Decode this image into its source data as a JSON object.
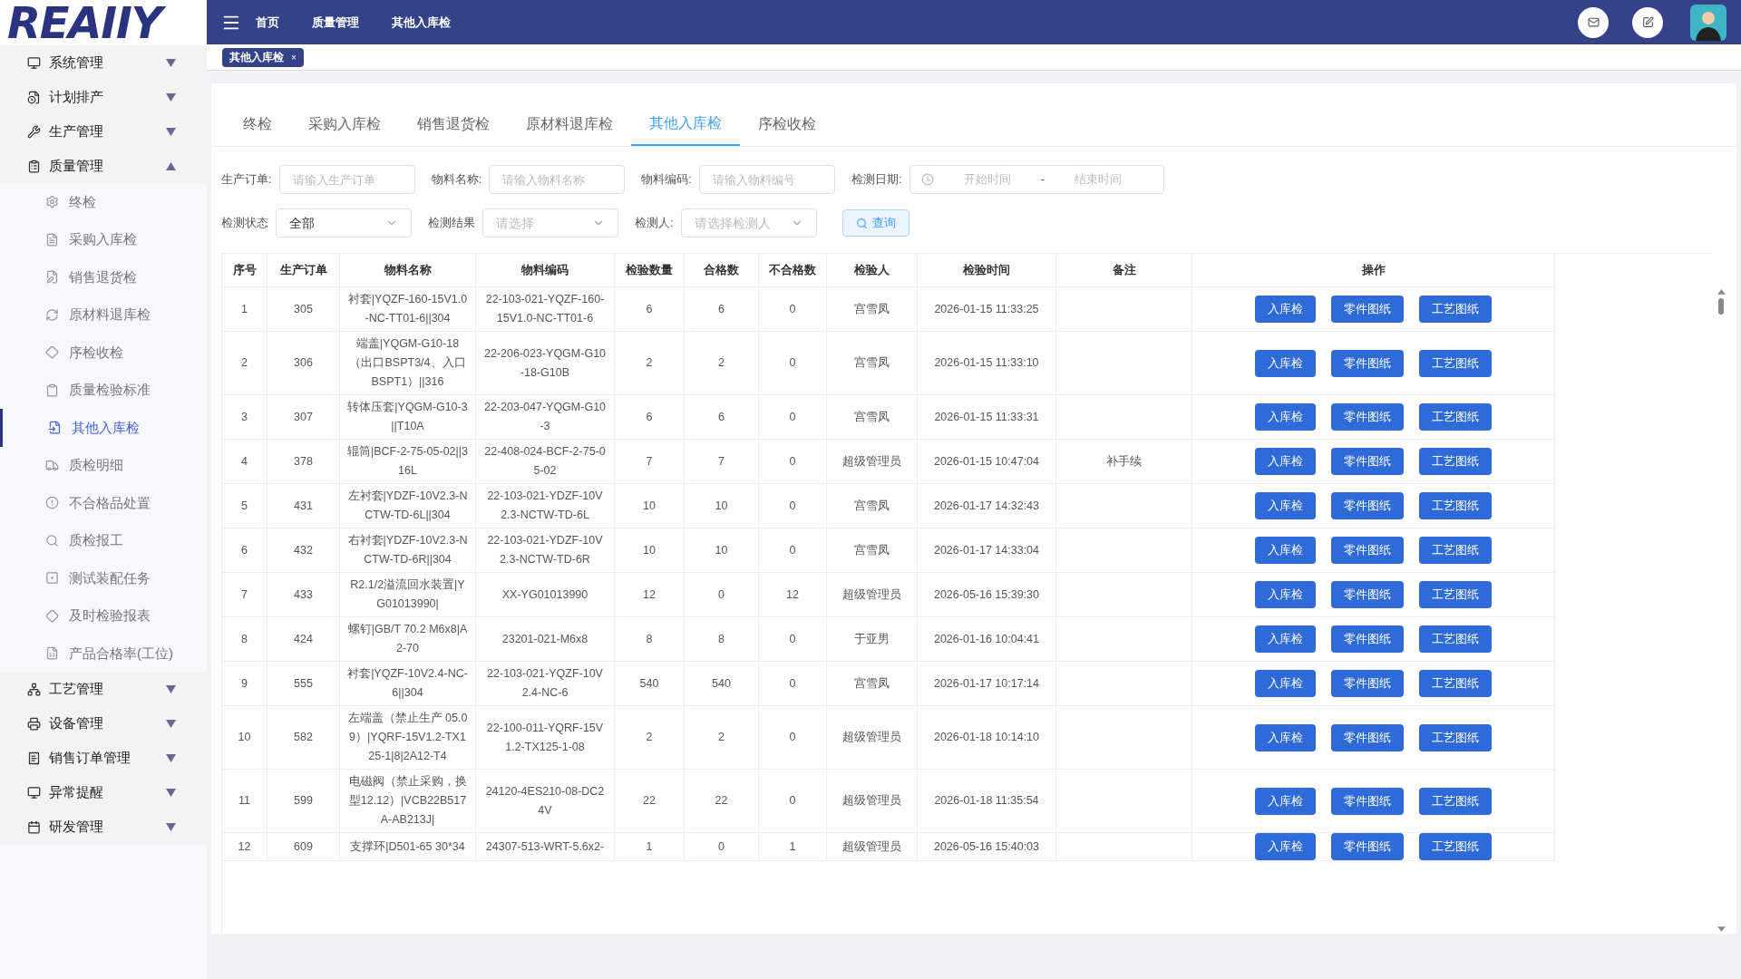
{
  "logo": "REAIIY",
  "sidebar": {
    "items": [
      {
        "label": "系统管理",
        "expanded": false
      },
      {
        "label": "计划排产",
        "expanded": false
      },
      {
        "label": "生产管理",
        "expanded": false
      },
      {
        "label": "质量管理",
        "expanded": true,
        "children": [
          {
            "label": "终检",
            "selected": false
          },
          {
            "label": "采购入库检",
            "selected": false
          },
          {
            "label": "销售退货检",
            "selected": false
          },
          {
            "label": "原材料退库检",
            "selected": false
          },
          {
            "label": "序检收检",
            "selected": false
          },
          {
            "label": "质量检验标准",
            "selected": false
          },
          {
            "label": "其他入库检",
            "selected": true
          },
          {
            "label": "质检明细",
            "selected": false
          },
          {
            "label": "不合格品处置",
            "selected": false
          },
          {
            "label": "质检报工",
            "selected": false
          },
          {
            "label": "测试装配任务",
            "selected": false
          },
          {
            "label": "及时检验报表",
            "selected": false
          },
          {
            "label": "产品合格率(工位)",
            "selected": false
          }
        ]
      },
      {
        "label": "工艺管理",
        "expanded": false
      },
      {
        "label": "设备管理",
        "expanded": false
      },
      {
        "label": "销售订单管理",
        "expanded": false
      },
      {
        "label": "异常提醒",
        "expanded": false
      },
      {
        "label": "研发管理",
        "expanded": false
      }
    ]
  },
  "breadcrumb": [
    "首页",
    "质量管理",
    "其他入库检"
  ],
  "open_tabs": [
    {
      "label": "其他入库检",
      "close": "×",
      "selected": true
    }
  ],
  "tabs": [
    {
      "label": "终检",
      "selected": false
    },
    {
      "label": "采购入库检",
      "selected": false
    },
    {
      "label": "销售退货检",
      "selected": false
    },
    {
      "label": "原材料退库检",
      "selected": false
    },
    {
      "label": "其他入库检",
      "selected": true
    },
    {
      "label": "序检收检",
      "selected": false
    }
  ],
  "filters": [
    [
      {
        "kind": "input",
        "label": "生产订单:",
        "placeholder": "请输入生产订单"
      },
      {
        "kind": "input",
        "label": "物料名称:",
        "placeholder": "请输入物料名称"
      },
      {
        "kind": "input",
        "label": "物料编码:",
        "placeholder": "请输入物料编号"
      },
      {
        "kind": "date",
        "label": "检测日期:",
        "start": "开始时间",
        "separator": "-",
        "end": "结束时间"
      }
    ],
    [
      {
        "kind": "select",
        "label": "检测状态",
        "value": "全部"
      },
      {
        "kind": "select",
        "label": "检测结果",
        "placeholder": "请选择"
      },
      {
        "kind": "select",
        "label": "检测人:",
        "placeholder": "请选择检测人"
      },
      {
        "kind": "button",
        "label": "查询"
      }
    ]
  ],
  "table": {
    "columns": [
      "序号",
      "生产订单",
      "物料名称",
      "物料编码",
      "检验数量",
      "合格数",
      "不合格数",
      "检验人",
      "检验时间",
      "备注",
      "操作"
    ],
    "rows": [
      {
        "cells": [
          "1",
          "305",
          "衬套|YQZF-160-15V1.0-NC-TT01-6||304",
          "22-103-021-YQZF-160-15V1.0-NC-TT01-6",
          "6",
          "6",
          "0",
          "宫雪凤",
          "2026-01-15 11:33:25"
        ],
        "actions": [
          "入库检",
          "零件图纸",
          "工艺图纸"
        ]
      },
      {
        "cells": [
          "2",
          "306",
          "端盖|YQGM-G10-18（出口BSPT3/4、入口BSPT1）||316",
          "22-206-023-YQGM-G10-18-G10B",
          "2",
          "2",
          "0",
          "宫雪凤",
          "2026-01-15 11:33:10"
        ],
        "actions": [
          "入库检",
          "零件图纸",
          "工艺图纸"
        ]
      },
      {
        "cells": [
          "3",
          "307",
          "转体压套|YQGM-G10-3||T10A",
          "22-203-047-YQGM-G10-3",
          "6",
          "6",
          "0",
          "宫雪凤",
          "2026-01-15 11:33:31"
        ],
        "actions": [
          "入库检",
          "零件图纸",
          "工艺图纸"
        ]
      },
      {
        "cells": [
          "4",
          "378",
          "辊筒|BCF-2-75-05-02||316L",
          "22-408-024-BCF-2-75-05-02",
          "7",
          "7",
          "0",
          "超级管理员",
          "2026-01-15 10:47:04",
          "补手续"
        ],
        "actions": [
          "入库检",
          "零件图纸",
          "工艺图纸"
        ]
      },
      {
        "cells": [
          "5",
          "431",
          "左衬套|YDZF-10V2.3-NCTW-TD-6L||304",
          "22-103-021-YDZF-10V2.3-NCTW-TD-6L",
          "10",
          "10",
          "0",
          "宫雪凤",
          "2026-01-17 14:32:43"
        ],
        "actions": [
          "入库检",
          "零件图纸",
          "工艺图纸"
        ]
      },
      {
        "cells": [
          "6",
          "432",
          "右衬套|YDZF-10V2.3-NCTW-TD-6R||304",
          "22-103-021-YDZF-10V2.3-NCTW-TD-6R",
          "10",
          "10",
          "0",
          "宫雪凤",
          "2026-01-17 14:33:04"
        ],
        "actions": [
          "入库检",
          "零件图纸",
          "工艺图纸"
        ]
      },
      {
        "cells": [
          "7",
          "433",
          "R2.1/2溢流回水装置|YG01013990|",
          "XX-YG01013990",
          "12",
          "0",
          "12",
          "超级管理员",
          "2026-05-16 15:39:30"
        ],
        "actions": [
          "入库检",
          "零件图纸",
          "工艺图纸"
        ]
      },
      {
        "cells": [
          "8",
          "424",
          "螺钉|GB/T 70.2 M6x8|A2-70",
          "23201-021-M6x8",
          "8",
          "8",
          "0",
          "于亚男",
          "2026-01-16 10:04:41"
        ],
        "actions": [
          "入库检",
          "零件图纸",
          "工艺图纸"
        ]
      },
      {
        "cells": [
          "9",
          "555",
          "衬套|YQZF-10V2.4-NC-6||304",
          "22-103-021-YQZF-10V2.4-NC-6",
          "540",
          "540",
          "0",
          "宫雪凤",
          "2026-01-17 10:17:14"
        ],
        "actions": [
          "入库检",
          "零件图纸",
          "工艺图纸"
        ]
      },
      {
        "cells": [
          "10",
          "582",
          "左端盖（禁止生产 05.09）|YQRF-15V1.2-TX125-1|8|2A12-T4",
          "22-100-011-YQRF-15V1.2-TX125-1-08",
          "2",
          "2",
          "0",
          "超级管理员",
          "2026-01-18 10:14:10"
        ],
        "actions": [
          "入库检",
          "零件图纸",
          "工艺图纸"
        ]
      },
      {
        "cells": [
          "11",
          "599",
          "电磁阀（禁止采购，换型12.12）|VCB22B517A-AB213J|",
          "24120-4ES210-08-DC24V",
          "22",
          "22",
          "0",
          "超级管理员",
          "2026-01-18 11:35:54"
        ],
        "actions": [
          "入库检",
          "零件图纸",
          "工艺图纸"
        ]
      },
      {
        "cells": [
          "12",
          "609",
          "支撑环|D501-65 30*34",
          "24307-513-WRT-5.6x2-",
          "1",
          "0",
          "1",
          "超级管理员",
          "2026-05-16 15:40:03"
        ],
        "actions": [
          "入库检",
          "零件图纸",
          "工艺图纸"
        ]
      }
    ]
  }
}
